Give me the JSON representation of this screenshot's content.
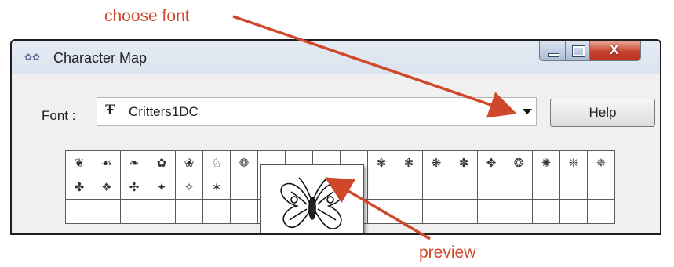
{
  "annotations": {
    "choose_font": "choose font",
    "preview": "preview",
    "arrow_color": "#d0482b"
  },
  "window": {
    "title": "Character Map",
    "app_icon": "character-map-icon",
    "controls": [
      "minimize-icon",
      "maximize-icon",
      "close-icon"
    ]
  },
  "font": {
    "label": "Font :",
    "value": "Critters1DC",
    "type_icon": "truetype-icon",
    "dropdown_icon": "chevron-down-icon"
  },
  "help_button": "Help",
  "grid": {
    "row1": [
      "❦",
      "☙",
      "❧",
      "✿",
      "❀",
      "♘",
      "❁",
      "",
      "",
      "",
      "",
      "✾",
      "❃",
      "❋",
      "✽",
      "✥",
      "❂",
      "✺",
      "❈",
      "✵"
    ],
    "row2": [
      "✤",
      "❖",
      "✣",
      "✦",
      "✧",
      "✶",
      "",
      "",
      "",
      "",
      "",
      "",
      "",
      "",
      "",
      "",
      "",
      "",
      "",
      ""
    ],
    "row3": [
      "",
      "",
      "",
      "",
      "",
      "",
      "",
      "",
      "",
      "",
      "",
      "",
      "",
      "",
      "",
      "",
      "",
      "",
      "",
      ""
    ]
  },
  "preview": {
    "icon": "butterfly-glyph-icon"
  }
}
